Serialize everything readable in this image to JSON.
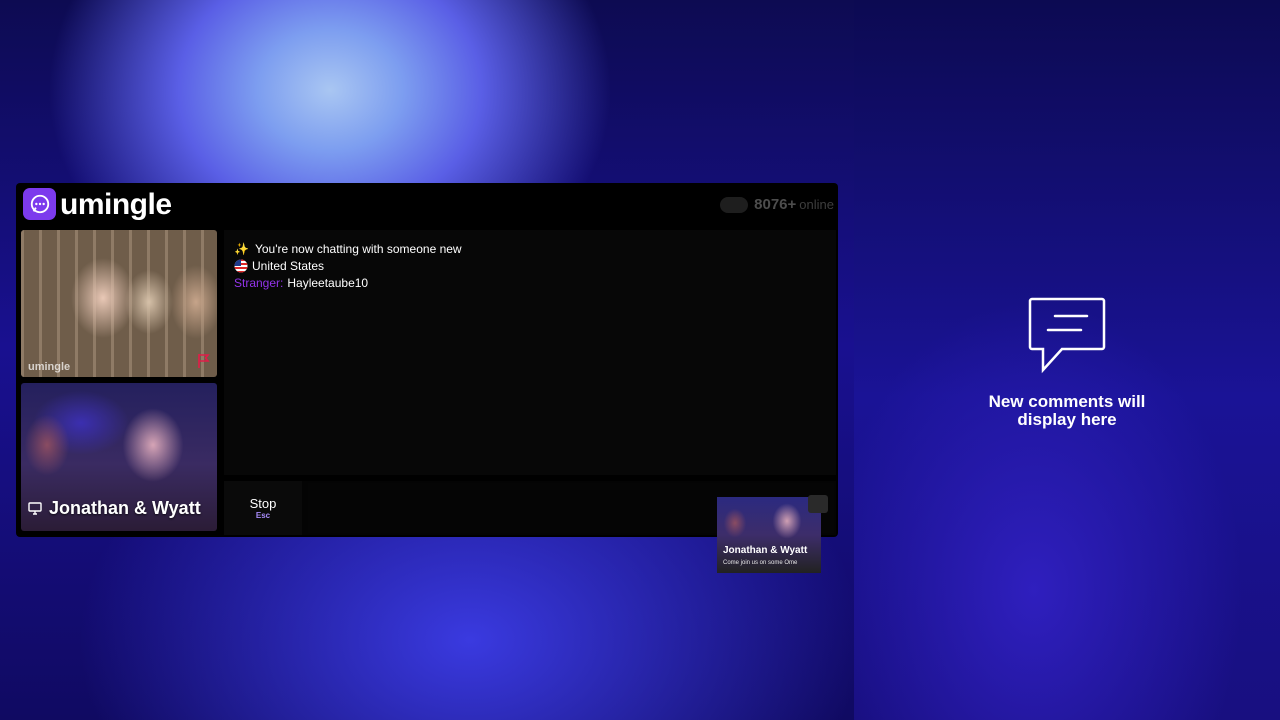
{
  "brand": {
    "name": "umingle",
    "logo_icon": "chat-bubble-icon",
    "accent": "#7c3aed"
  },
  "status": {
    "online_count": "8076+",
    "online_label": "online"
  },
  "videos": {
    "local_watermark": "umingle",
    "remote_label": "Jonathan & Wyatt",
    "remote_icon": "monitor-icon"
  },
  "chat": {
    "system_message": "You're now chatting with someone new",
    "system_icon": "sparkles-icon",
    "country": "United States",
    "country_icon": "us-flag-icon",
    "stranger_prefix": "Stranger:",
    "stranger_name": "Hayleetaube10",
    "stranger_color": "#9333ea"
  },
  "controls": {
    "stop_label": "Stop",
    "stop_key": "Esc"
  },
  "stream_thumbnail": {
    "title": "Jonathan & Wyatt",
    "subtitle": "Come join us on some Ome"
  },
  "comments": {
    "empty_text": "New comments will display here",
    "icon": "comment-bubble-icon"
  }
}
